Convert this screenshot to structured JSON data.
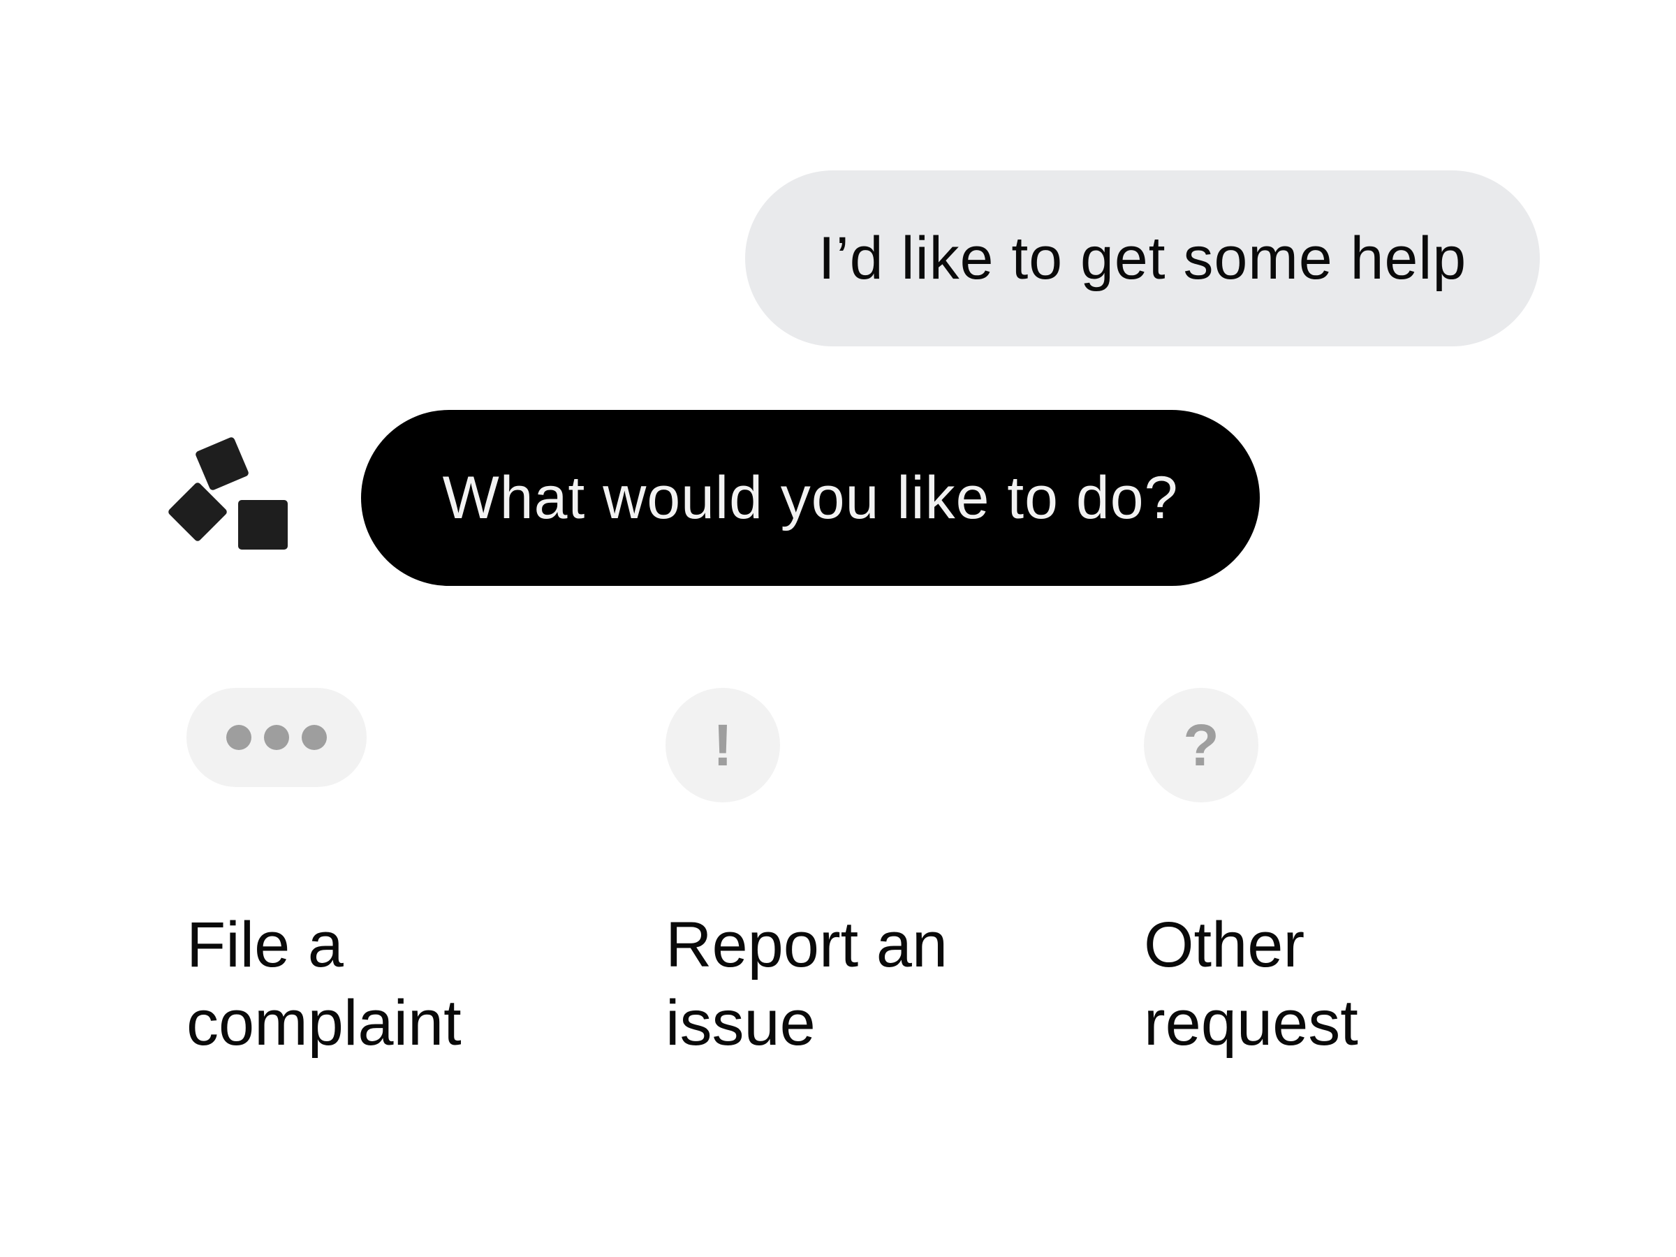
{
  "conversation": {
    "user_message": "I’d like to get some help",
    "bot_message": "What would you like to do?"
  },
  "bot_avatar": {
    "icon": "blocks-logo-icon"
  },
  "options": [
    {
      "icon": "more-dots-icon",
      "label_line1": "File a",
      "label_line2": "complaint"
    },
    {
      "icon": "exclamation-icon",
      "icon_glyph": "!",
      "label_line1": "Report an",
      "label_line2": "issue"
    },
    {
      "icon": "question-icon",
      "icon_glyph": "?",
      "label_line1": "Other",
      "label_line2": "request"
    }
  ],
  "colors": {
    "user_bubble": "#e9eaec",
    "bot_bubble": "#000000",
    "icon_background": "#f2f2f2",
    "icon_glyph": "#9e9e9e"
  }
}
